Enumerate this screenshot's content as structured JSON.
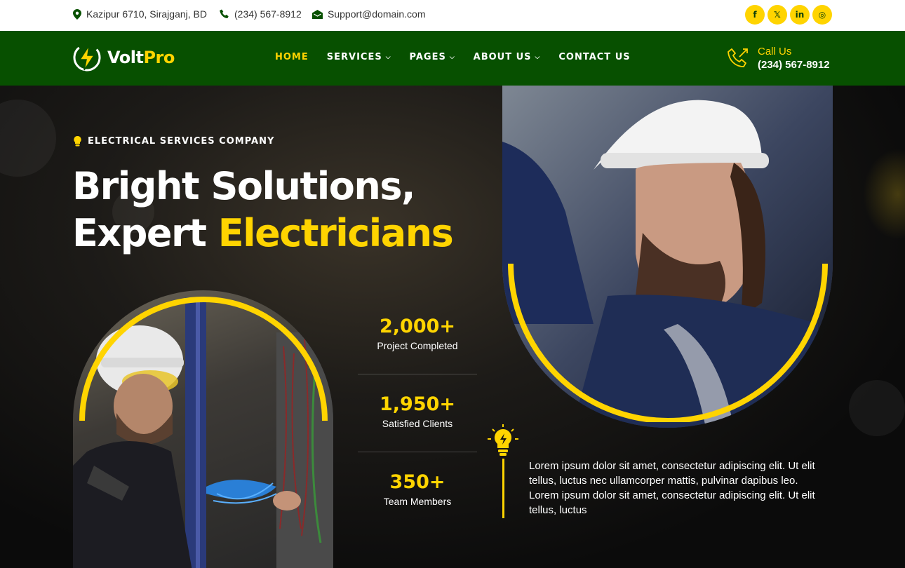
{
  "topbar": {
    "address": "Kazipur 6710, Sirajganj, BD",
    "phone": "(234) 567-8912",
    "email": "Support@domain.com",
    "socials": [
      "f",
      "𝕏",
      "in",
      "◎"
    ]
  },
  "brand": {
    "name_part1": "Volt",
    "name_part2": "Pro"
  },
  "nav": {
    "home": "HOME",
    "services": "SERVICES",
    "pages": "PAGES",
    "about": "ABOUT US",
    "contact": "CONTACT US"
  },
  "call": {
    "label": "Call Us",
    "number": "(234) 567-8912"
  },
  "hero": {
    "tagline": "ELECTRICAL SERVICES COMPANY",
    "title_line1": "Bright Solutions,",
    "title_line2_plain": "Expert ",
    "title_line2_highlight": "Electricians",
    "description": "Lorem ipsum dolor sit amet, consectetur adipiscing elit. Ut elit tellus, luctus nec ullamcorper mattis, pulvinar dapibus leo. Lorem ipsum dolor sit amet, consectetur adipiscing elit. Ut elit tellus, luctus"
  },
  "stats": [
    {
      "value": "2,000+",
      "label": "Project Completed"
    },
    {
      "value": "1,950+",
      "label": "Satisfied Clients"
    },
    {
      "value": "350+",
      "label": "Team Members"
    }
  ],
  "colors": {
    "brand_green": "#075000",
    "accent_yellow": "#FFD400"
  }
}
